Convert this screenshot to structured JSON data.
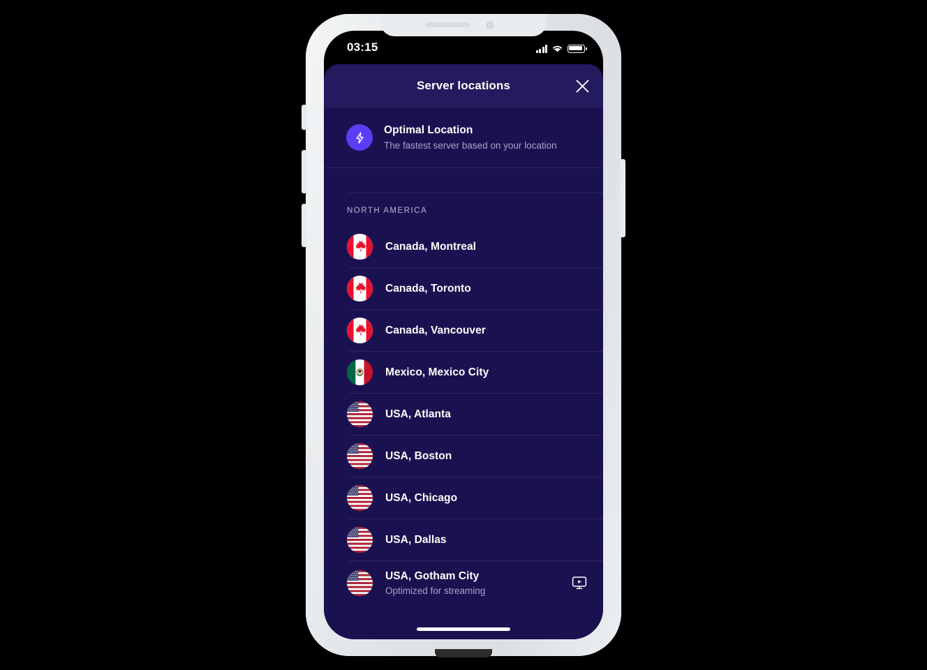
{
  "device": {
    "status_bar": {
      "time": "03:15",
      "signal_icon": "cellular-signal-icon",
      "wifi_icon": "wifi-icon",
      "battery_icon": "battery-icon"
    },
    "home_indicator": "home-indicator"
  },
  "header": {
    "title": "Server locations",
    "close_label": "close-icon"
  },
  "optimal": {
    "icon": "lightning-bolt-icon",
    "title": "Optimal Location",
    "subtitle": "The fastest server based on your location",
    "accent_color": "#5b3df5"
  },
  "sections": [
    {
      "label": "NORTH AMERICA",
      "items": [
        {
          "name": "Canada, Montreal",
          "flag": "flag-canada"
        },
        {
          "name": "Canada, Toronto",
          "flag": "flag-canada"
        },
        {
          "name": "Canada, Vancouver",
          "flag": "flag-canada"
        },
        {
          "name": "Mexico, Mexico City",
          "flag": "flag-mexico"
        },
        {
          "name": "USA, Atlanta",
          "flag": "flag-usa"
        },
        {
          "name": "USA, Boston",
          "flag": "flag-usa"
        },
        {
          "name": "USA, Chicago",
          "flag": "flag-usa"
        },
        {
          "name": "USA, Dallas",
          "flag": "flag-usa"
        },
        {
          "name": "USA, Gotham City",
          "flag": "flag-usa",
          "subtitle": "Optimized for streaming",
          "badge_icon": "streaming-monitor-icon"
        }
      ]
    }
  ],
  "colors": {
    "app_background": "#1a1150",
    "header_background": "#241a5e",
    "accent": "#5b3df5",
    "text_primary": "#ffffff",
    "text_secondary": "#a9a2c9",
    "frame": "#e4e7ea"
  }
}
